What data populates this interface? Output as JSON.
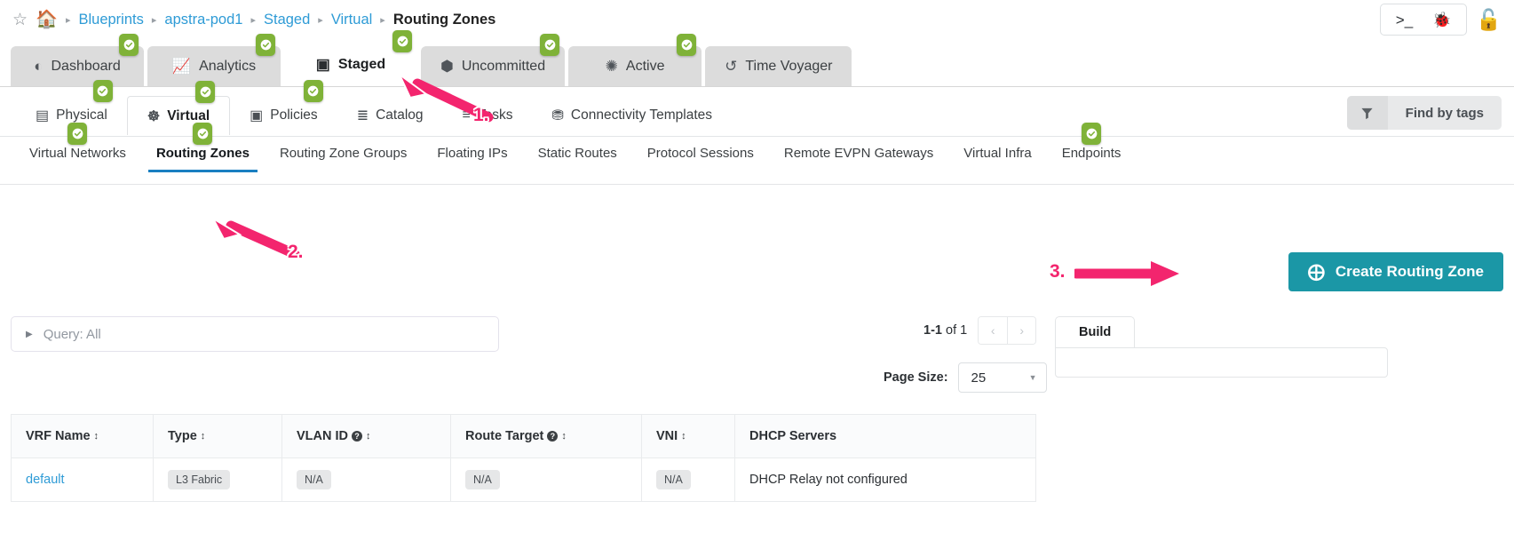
{
  "breadcrumb": {
    "star_icon": "star-icon",
    "home_icon": "home-icon",
    "separator": "▸",
    "items": [
      {
        "label": "Blueprints",
        "current": false
      },
      {
        "label": "apstra-pod1",
        "current": false
      },
      {
        "label": "Staged",
        "current": false
      },
      {
        "label": "Virtual",
        "current": false
      },
      {
        "label": "Routing Zones",
        "current": true
      }
    ]
  },
  "top_right": {
    "terminal_icon": ">_",
    "bug_icon": "🐞",
    "lock_icon": "🔓"
  },
  "tabs_primary": [
    {
      "label": "Dashboard",
      "icon": "◔",
      "badge": true,
      "active": false
    },
    {
      "label": "Analytics",
      "icon": "📈",
      "badge": true,
      "active": false
    },
    {
      "label": "Staged",
      "icon": "▣",
      "badge": true,
      "active": true
    },
    {
      "label": "Uncommitted",
      "icon": "⬢",
      "badge": true,
      "active": false
    },
    {
      "label": "Active",
      "icon": "✺",
      "badge": true,
      "active": false
    },
    {
      "label": "Time Voyager",
      "icon": "↺",
      "badge": false,
      "active": false
    }
  ],
  "tabs_secondary": [
    {
      "label": "Physical",
      "icon": "☰",
      "badge": true,
      "active": false
    },
    {
      "label": "Virtual",
      "icon": "☸",
      "badge": true,
      "active": true
    },
    {
      "label": "Policies",
      "icon": "▣",
      "badge": true,
      "active": false
    },
    {
      "label": "Catalog",
      "icon": "≣",
      "badge": false,
      "active": false
    },
    {
      "label": "Tasks",
      "icon": "≡",
      "badge": false,
      "active": false
    },
    {
      "label": "Connectivity Templates",
      "icon": "⛓",
      "badge": false,
      "active": false
    }
  ],
  "tabs_tertiary": [
    {
      "label": "Virtual Networks",
      "badge": true,
      "active": false
    },
    {
      "label": "Routing Zones",
      "badge": true,
      "active": true
    },
    {
      "label": "Routing Zone Groups",
      "badge": false,
      "active": false
    },
    {
      "label": "Floating IPs",
      "badge": false,
      "active": false
    },
    {
      "label": "Static Routes",
      "badge": false,
      "active": false
    },
    {
      "label": "Protocol Sessions",
      "badge": false,
      "active": false
    },
    {
      "label": "Remote EVPN Gateways",
      "badge": false,
      "active": false
    },
    {
      "label": "Virtual Infra",
      "badge": false,
      "active": false
    },
    {
      "label": "Endpoints",
      "badge": true,
      "active": false
    }
  ],
  "find_by_tags": {
    "label": "Find by tags",
    "icon": "filter-funnel-icon"
  },
  "create_button": {
    "label": "Create Routing Zone",
    "plus": "⊕",
    "color": "#1b97a6"
  },
  "query": {
    "label": "Query: All",
    "triangle": "▶"
  },
  "pagination": {
    "range": "1-1",
    "of_text": "of 1",
    "prev": "‹",
    "next": "›",
    "page_size_label": "Page Size:",
    "page_size_value": "25",
    "caret": "▼"
  },
  "build_panel": {
    "tab_label": "Build"
  },
  "table": {
    "columns": [
      {
        "label": "VRF Name",
        "sortable": true,
        "help": false
      },
      {
        "label": "Type",
        "sortable": true,
        "help": false
      },
      {
        "label": "VLAN ID",
        "sortable": true,
        "help": true
      },
      {
        "label": "Route Target",
        "sortable": true,
        "help": true
      },
      {
        "label": "VNI",
        "sortable": true,
        "help": false
      },
      {
        "label": "DHCP Servers",
        "sortable": false,
        "help": false
      }
    ],
    "rows": [
      {
        "vrf_name": "default",
        "type": "L3 Fabric",
        "vlan_id": "N/A",
        "route_target": "N/A",
        "vni": "N/A",
        "dhcp_servers": "DHCP Relay not configured"
      }
    ]
  },
  "annotations": [
    {
      "number": "1.",
      "color": "#f3256e"
    },
    {
      "number": "2.",
      "color": "#f3256e"
    },
    {
      "number": "3.",
      "color": "#f3256e"
    }
  ]
}
